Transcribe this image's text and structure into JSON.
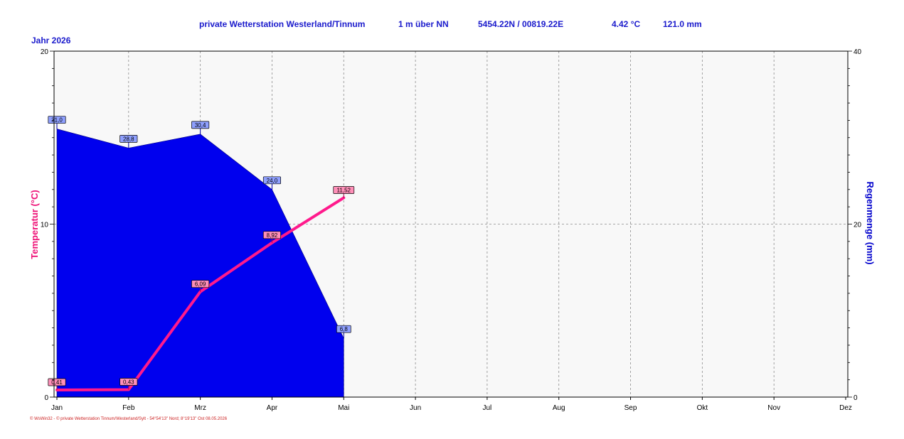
{
  "header": {
    "station": "private Wetterstation Westerland/Tinnum",
    "altitude": "1 m über NN",
    "coords": "5454.22N / 00819.22E",
    "temperature": "4.42 °C",
    "rain": "121.0 mm"
  },
  "year_label": "Jahr  2026",
  "footer": "© WsWin32  -  © private Wetterstation Tinnum/Westerland/Sylt  -  54°54'13\" Nord; 8°19'13\" Ost  08.05.2026",
  "colors": {
    "temp_line": "#ff1a8c",
    "rain_fill": "#0000ee",
    "rain_axis_title": "#0000cc",
    "temp_axis_title": "#ee1177",
    "grid": "#8c8c8c",
    "plot_bg": "#f8f8f8"
  },
  "chart_data": {
    "type": "area",
    "categories": [
      "Jan",
      "Feb",
      "Mrz",
      "Apr",
      "Mai",
      "Jun",
      "Jul",
      "Aug",
      "Sep",
      "Okt",
      "Nov",
      "Dez"
    ],
    "series": [
      {
        "type": "line",
        "axis": "left",
        "values": [
          0.41,
          0.43,
          6.09,
          8.92,
          11.52
        ],
        "labels": [
          "0,41",
          "0,43",
          "6,09",
          "8,92",
          "11,52"
        ]
      },
      {
        "type": "area",
        "axis": "right",
        "values": [
          31.0,
          28.8,
          30.4,
          24.0,
          6.8
        ],
        "labels": [
          "31,0",
          "28,8",
          "30,4",
          "24,0",
          "6,8"
        ]
      }
    ],
    "ylabel_left": "Temperatur  (°C)",
    "ylabel_right": "Regenmenge  (mm)",
    "ylim_left": [
      0,
      20
    ],
    "ylim_right": [
      0,
      40
    ],
    "yticks_left": [
      "0",
      "10",
      "20"
    ],
    "yticks_right": [
      "0",
      "20",
      "40"
    ],
    "grid": true,
    "legend": "none"
  }
}
